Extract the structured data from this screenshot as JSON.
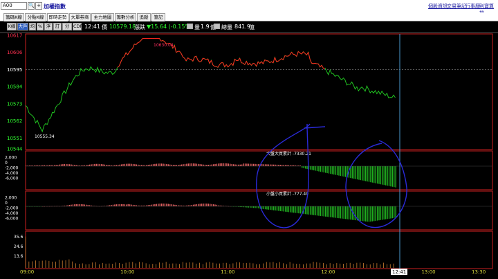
{
  "topbar": {
    "symbol_value": "A00",
    "search_glyph": "🔍",
    "plus_glyph": "+",
    "title": "加權指數",
    "links": [
      "個股資訊",
      "交易筆記",
      "行事曆",
      "則寶算機"
    ]
  },
  "tabs": [
    {
      "label": "籌碼K線",
      "active": false
    },
    {
      "label": "分點K線",
      "active": false
    },
    {
      "label": "即時走勢",
      "active": true
    },
    {
      "label": "大單券商",
      "active": false
    },
    {
      "label": "主力地圖",
      "active": false
    },
    {
      "label": "籌數分析",
      "active": false
    },
    {
      "label": "追蹤",
      "active": false
    },
    {
      "label": "筆記",
      "active": false
    }
  ],
  "toolbar": {
    "buttons": [
      {
        "label": "K線",
        "selected": false
      },
      {
        "label": "大戶",
        "selected": true
      },
      {
        "label": "均",
        "selected": false
      },
      {
        "label": "%",
        "selected": false
      },
      {
        "label": "浮",
        "selected": false
      },
      {
        "label": "訂",
        "selected": false
      },
      {
        "label": "分價",
        "selected": false
      },
      {
        "label": "CDP",
        "selected": false
      }
    ],
    "time": "12:41",
    "price_label": "價",
    "price": "10579.18",
    "change_label": "漲跌",
    "change": "▼15.64 (-0.15%)",
    "volume_label": "量",
    "volume": "1.9",
    "volume_unit": "億",
    "total_label": "總量",
    "total": "841.9",
    "total_unit": "億"
  },
  "price_axis": {
    "ticks": [
      {
        "v": 10617,
        "label": "10617",
        "color": "#ff3050"
      },
      {
        "v": 10606,
        "label": "10606",
        "color": "#ff3050"
      },
      {
        "v": 10595,
        "label": "10595",
        "color": "#ffffff"
      },
      {
        "v": 10584,
        "label": "10584",
        "color": "#30ff30"
      },
      {
        "v": 10573,
        "label": "10573",
        "color": "#30ff30"
      },
      {
        "v": 10562,
        "label": "10562",
        "color": "#30ff30"
      },
      {
        "v": 10551,
        "label": "10551",
        "color": "#30ff30"
      },
      {
        "v": 10544,
        "label": "10544",
        "color": "#30ff30"
      }
    ],
    "ref_price": 10595
  },
  "annotations": {
    "high": "10630.04",
    "low": "10555.34",
    "big_label": "大盤大買累計 -7330.21",
    "small_label": "小盤小買累計 -777.49"
  },
  "panel_ticks": [
    "2,000",
    "0",
    "-2,000",
    "-4,000",
    "-6,000"
  ],
  "volume_ticks": [
    "35.6",
    "24.6",
    "13.6"
  ],
  "time_axis": [
    "09:00",
    "10:00",
    "11:00",
    "12:00",
    "13:00",
    "13:30"
  ],
  "time_cursor": "12:41",
  "colors": {
    "up": "#ff2020",
    "down": "#20c020",
    "bar_up": "#e06060",
    "bar_down": "#20b020",
    "volume": "#d08030",
    "panel_border": "#cc2020",
    "cursor": "#4a9ad0",
    "circle": "#2a2ad8"
  }
}
